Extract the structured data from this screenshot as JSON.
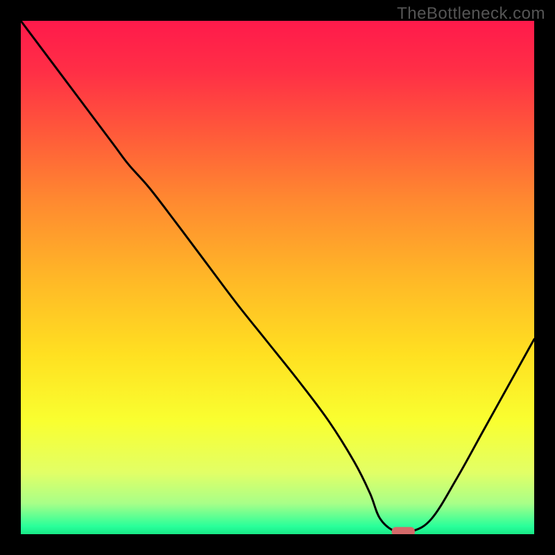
{
  "watermark": "TheBottleneck.com",
  "chart_data": {
    "type": "line",
    "title": "",
    "xlabel": "",
    "ylabel": "",
    "xlim": [
      0,
      100
    ],
    "ylim": [
      0,
      100
    ],
    "background_gradient": {
      "stops": [
        {
          "offset": 0.0,
          "color": "#ff1a4b"
        },
        {
          "offset": 0.1,
          "color": "#ff2f46"
        },
        {
          "offset": 0.22,
          "color": "#ff5a3a"
        },
        {
          "offset": 0.35,
          "color": "#ff8930"
        },
        {
          "offset": 0.5,
          "color": "#ffb727"
        },
        {
          "offset": 0.65,
          "color": "#ffe021"
        },
        {
          "offset": 0.78,
          "color": "#f9ff30"
        },
        {
          "offset": 0.88,
          "color": "#e2ff66"
        },
        {
          "offset": 0.94,
          "color": "#a8ff88"
        },
        {
          "offset": 0.985,
          "color": "#28ff9a"
        },
        {
          "offset": 1.0,
          "color": "#18e886"
        }
      ]
    },
    "series": [
      {
        "name": "bottleneck-curve",
        "x": [
          0,
          6,
          12,
          18,
          21,
          25,
          30,
          36,
          42,
          48,
          54,
          60,
          65,
          68,
          70,
          73,
          76,
          80,
          85,
          90,
          95,
          100
        ],
        "y": [
          100,
          92,
          84,
          76,
          72,
          67.5,
          61,
          53,
          45,
          37.5,
          30,
          22,
          14,
          8,
          3,
          0.5,
          0.5,
          3,
          11,
          20,
          29,
          38
        ]
      }
    ],
    "marker": {
      "name": "optimal-point",
      "x": 74.5,
      "y": 0.5,
      "color": "#d46a6a",
      "width_pct": 4.5,
      "height_pct": 1.8
    }
  }
}
